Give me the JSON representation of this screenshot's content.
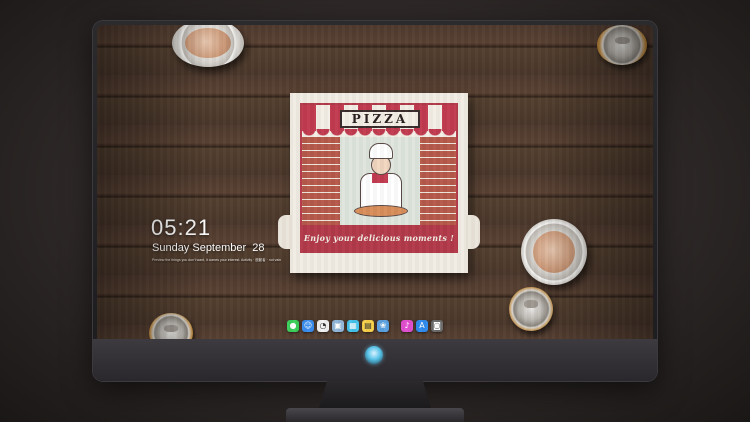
{
  "lockscreen": {
    "time": "05:21",
    "date": "Sunday September  28",
    "quote": "Preview the things you don't want, it comes your interest. Activity · 鼓動者 · not vain"
  },
  "wallpaper": {
    "pizza_sign": "PIZZA",
    "pizza_banner": "Enjoy your delicious moments !"
  },
  "dock": {
    "group1": [
      {
        "name": "messages-icon",
        "glyph": "●",
        "color": "#3ccf5a"
      },
      {
        "name": "finder-icon",
        "glyph": "☺",
        "color": "#3a8ef0"
      },
      {
        "name": "clock-icon",
        "glyph": "◔",
        "color": "#f2f2f2"
      },
      {
        "name": "preview-icon",
        "glyph": "▣",
        "color": "#8fb6d9"
      },
      {
        "name": "clapper-icon",
        "glyph": "▦",
        "color": "#45c2ea"
      },
      {
        "name": "notes-icon",
        "glyph": "▤",
        "color": "#f5d04a"
      },
      {
        "name": "photos-icon",
        "glyph": "❀",
        "color": "#5aa0e0"
      }
    ],
    "group2": [
      {
        "name": "music-icon",
        "glyph": "♪",
        "color": "#e24fd0"
      },
      {
        "name": "app-store-icon",
        "glyph": "A",
        "color": "#2f8cf0"
      },
      {
        "name": "camera-icon",
        "glyph": "◙",
        "color": "#6a6a6a"
      }
    ]
  },
  "colors": {
    "accent_red": "#b23a4a",
    "wood": "#4a372b"
  }
}
